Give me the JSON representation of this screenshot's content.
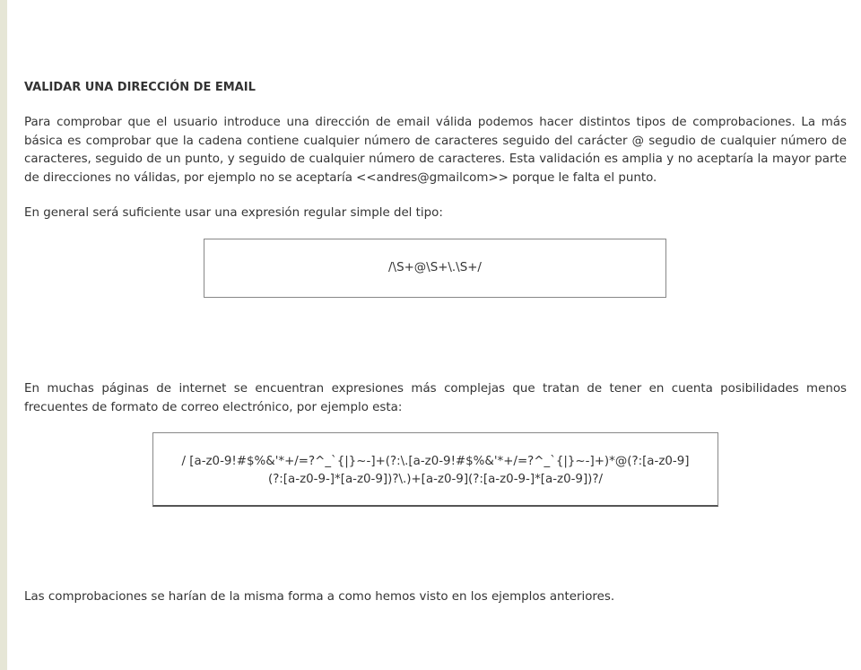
{
  "article": {
    "title": "VALIDAR UNA DIRECCIÓN DE EMAIL",
    "paragraph_1": "Para comprobar que el usuario introduce una dirección de email válida podemos hacer distintos tipos de comprobaciones. La más básica es comprobar que la cadena contiene cualquier número de caracteres seguido del carácter @ segudio de cualquier número de caracteres, seguido de un punto, y seguido de cualquier número de caracteres. Esta validación es amplia y no aceptaría la mayor parte de direcciones no válidas, por ejemplo no se aceptaría <<andres@gmailcom>> porque le falta el punto.",
    "paragraph_2": "En general será suficiente usar una expresión regular simple del tipo:",
    "code_1": "/\\S+@\\S+\\.\\S+/",
    "paragraph_3": "En muchas páginas de internet se encuentran expresiones más complejas que tratan de tener en cuenta posibilidades menos frecuentes de formato de correo electrónico, por ejemplo esta:",
    "code_2_line_1": "/ [a-z0-9!#$%&'*+/=?^_`{|}~-]+(?:\\.[a-z0-9!#$%&'*+/=?^_`{|}~-]+)*@(?:[a-z0-9]",
    "code_2_line_2": "(?:[a-z0-9-]*[a-z0-9])?\\.)+[a-z0-9](?:[a-z0-9-]*[a-z0-9])?/",
    "paragraph_4": "Las comprobaciones se harían de la misma forma a como hemos visto en los ejemplos anteriores."
  },
  "colors": {
    "text": "#333333",
    "left_strip": "#e6e6d6",
    "box_border": "#888888"
  }
}
